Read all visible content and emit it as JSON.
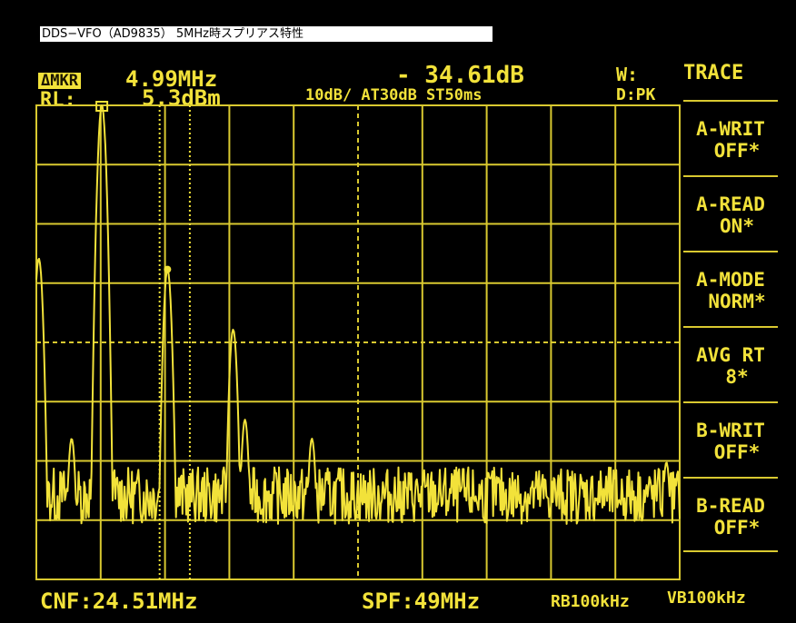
{
  "caption": "DDS−VFO（AD9835） 5MHz時スプリアス特性",
  "header": {
    "marker_label": "ΔMKR",
    "marker_freq": "4.99MHz",
    "ref_label": "RL:",
    "ref_level": "5.3dBm",
    "marker_level": "- 34.61dB",
    "settings": "10dB/ AT30dB ST50ms",
    "trace_mode": "W:",
    "detector": "D:PK"
  },
  "menu": {
    "title": "TRACE",
    "softkeys": [
      {
        "line1": "A-WRIT",
        "line2": "OFF*"
      },
      {
        "line1": "A-READ",
        "line2": "ON*"
      },
      {
        "line1": "A-MODE",
        "line2": "NORM*"
      },
      {
        "line1": "AVG RT",
        "line2": "8*"
      },
      {
        "line1": "B-WRIT",
        "line2": "OFF*"
      },
      {
        "line1": "B-READ",
        "line2": "OFF*"
      }
    ]
  },
  "footer": {
    "center_freq": "CNF:24.51MHz",
    "span": "SPF:49MHz",
    "rbw": "RB100kHz",
    "vbw": "VB100kHz"
  },
  "colors": {
    "trace": "#f2e23a",
    "grid": "#d9c930",
    "background": "#000000"
  },
  "chart_data": {
    "type": "line",
    "title": "",
    "xlabel": "",
    "ylabel": "",
    "x_unit": "MHz",
    "y_unit": "dBm",
    "xlim": [
      0.01,
      49.01
    ],
    "ylim": [
      -94.7,
      5.3
    ],
    "grid": true,
    "peaks": [
      {
        "x": 0.2,
        "y": -27
      },
      {
        "x": 5.0,
        "y": 5.3
      },
      {
        "x": 10.0,
        "y": -29.3
      },
      {
        "x": 15.0,
        "y": -42
      },
      {
        "x": 21.0,
        "y": -65
      },
      {
        "x": 15.9,
        "y": -61
      },
      {
        "x": 2.7,
        "y": -65
      },
      {
        "x": 48.0,
        "y": -70
      }
    ],
    "noise_floor": -77
  }
}
